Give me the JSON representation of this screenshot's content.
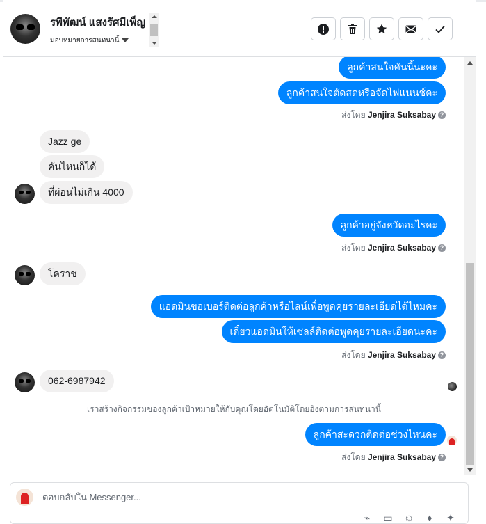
{
  "header": {
    "contact_name": "รพีพัฒน์ แสงรัศมีเพ็ญ",
    "assign_label": "มอบหมายการสนทนานี้",
    "actions": [
      {
        "name": "mark-spam-button",
        "icon": "alert-icon"
      },
      {
        "name": "delete-button",
        "icon": "trash-icon"
      },
      {
        "name": "star-button",
        "icon": "star-icon"
      },
      {
        "name": "mark-unread-button",
        "icon": "envelope-icon"
      },
      {
        "name": "mark-done-button",
        "icon": "check-icon"
      }
    ]
  },
  "messages": {
    "out1": "ลูกค้าสนใจคันนี้นะคะ",
    "out2": "ลูกค้าสนใจตัดสดหรือจัดไฟแนนช์คะ",
    "in1": "Jazz ge",
    "in2": "คันไหนก็ได้",
    "in3": "ที่ผ่อนไม่เกิน 4000",
    "out3": "ลูกค้าอยู่จังหวัดอะไรคะ",
    "in4": "โคราช",
    "out4": "แอดมินขอเบอร์ติดต่อลูกค้าหรือไลน์เพื่อพูดคุยรายละเอียดได้ไหมคะ",
    "out5": "เดี๋ยวแอดมินให้เซลล์ติดต่อพูดคุยรายละเอียดนะคะ",
    "in5": "062-6987942",
    "system_note": "เราสร้างกิจกรรมของลูกค้าเป้าหมายให้กับคุณโดยอัตโนมัติโดยอิงตามการสนทนานี้",
    "out6": "ลูกค้าสะดวกติดต่อช่วงไหนคะ"
  },
  "sent_by": {
    "prefix": "ส่งโดย",
    "agent": "Jenjira Suksabay",
    "info_glyph": "?"
  },
  "composer": {
    "placeholder": "ตอบกลับใน Messenger..."
  },
  "colors": {
    "outgoing_bubble": "#0084ff",
    "incoming_bubble": "#f1f0f0"
  }
}
